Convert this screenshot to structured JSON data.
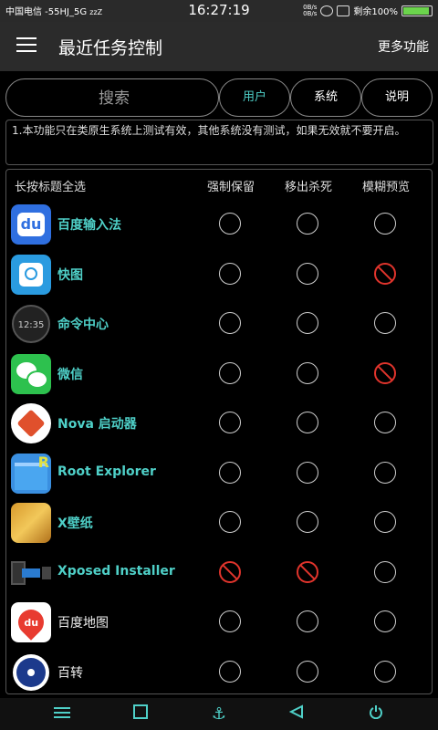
{
  "statusbar": {
    "carrier": "中国电信 -55HJ_5G",
    "sleep": "zzZ",
    "time": "16:27:19",
    "net_up": "0B/s",
    "net_down": "0B/s",
    "battery_label": "剩余100%",
    "battery_level": 1.0
  },
  "appbar": {
    "menu_icon": "menu-icon",
    "title": "最近任务控制",
    "more": "更多功能"
  },
  "search": {
    "placeholder": "搜索",
    "value": ""
  },
  "filters": [
    {
      "label": "用户",
      "active": true
    },
    {
      "label": "系统",
      "active": false
    },
    {
      "label": "说明",
      "active": false
    }
  ],
  "note": "1.本功能只在类原生系统上测试有效，其他系统没有测试，如果无效就不要开启。",
  "list": {
    "header": {
      "select_all": "长按标题全选",
      "col1": "强制保留",
      "col2": "移出杀死",
      "col3": "模糊预览"
    },
    "apps": [
      {
        "name": "百度输入法",
        "icon": "baidu-input-icon",
        "highlight": true,
        "keep": "off",
        "kill": "off",
        "blur": "off"
      },
      {
        "name": "快图",
        "icon": "quickpic-icon",
        "highlight": true,
        "keep": "off",
        "kill": "off",
        "blur": "forbidden"
      },
      {
        "name": "命令中心",
        "icon": "clock-icon",
        "highlight": true,
        "keep": "off",
        "kill": "off",
        "blur": "off"
      },
      {
        "name": "微信",
        "icon": "wechat-icon",
        "highlight": true,
        "keep": "off",
        "kill": "off",
        "blur": "forbidden"
      },
      {
        "name": "Nova 启动器",
        "icon": "nova-launcher-icon",
        "highlight": true,
        "keep": "off",
        "kill": "off",
        "blur": "off"
      },
      {
        "name": "Root Explorer",
        "icon": "root-explorer-icon",
        "highlight": true,
        "keep": "off",
        "kill": "off",
        "blur": "off"
      },
      {
        "name": "X壁纸",
        "icon": "x-wallpaper-icon",
        "highlight": true,
        "keep": "off",
        "kill": "off",
        "blur": "off"
      },
      {
        "name": "Xposed Installer",
        "icon": "xposed-icon",
        "highlight": true,
        "keep": "forbidden",
        "kill": "forbidden",
        "blur": "off"
      },
      {
        "name": "百度地图",
        "icon": "baidu-map-icon",
        "highlight": false,
        "keep": "off",
        "kill": "off",
        "blur": "off"
      },
      {
        "name": "百转",
        "icon": "film-reel-icon",
        "highlight": false,
        "keep": "off",
        "kill": "off",
        "blur": "off"
      }
    ]
  },
  "navbar": {
    "items": [
      "menu-icon",
      "square-icon",
      "anchor-icon",
      "back-triangle-icon",
      "power-icon"
    ]
  },
  "colors": {
    "accent": "#4fd0c8",
    "forbidden": "#e0342c",
    "appbar": "#2b2b2b",
    "background": "#000000"
  }
}
